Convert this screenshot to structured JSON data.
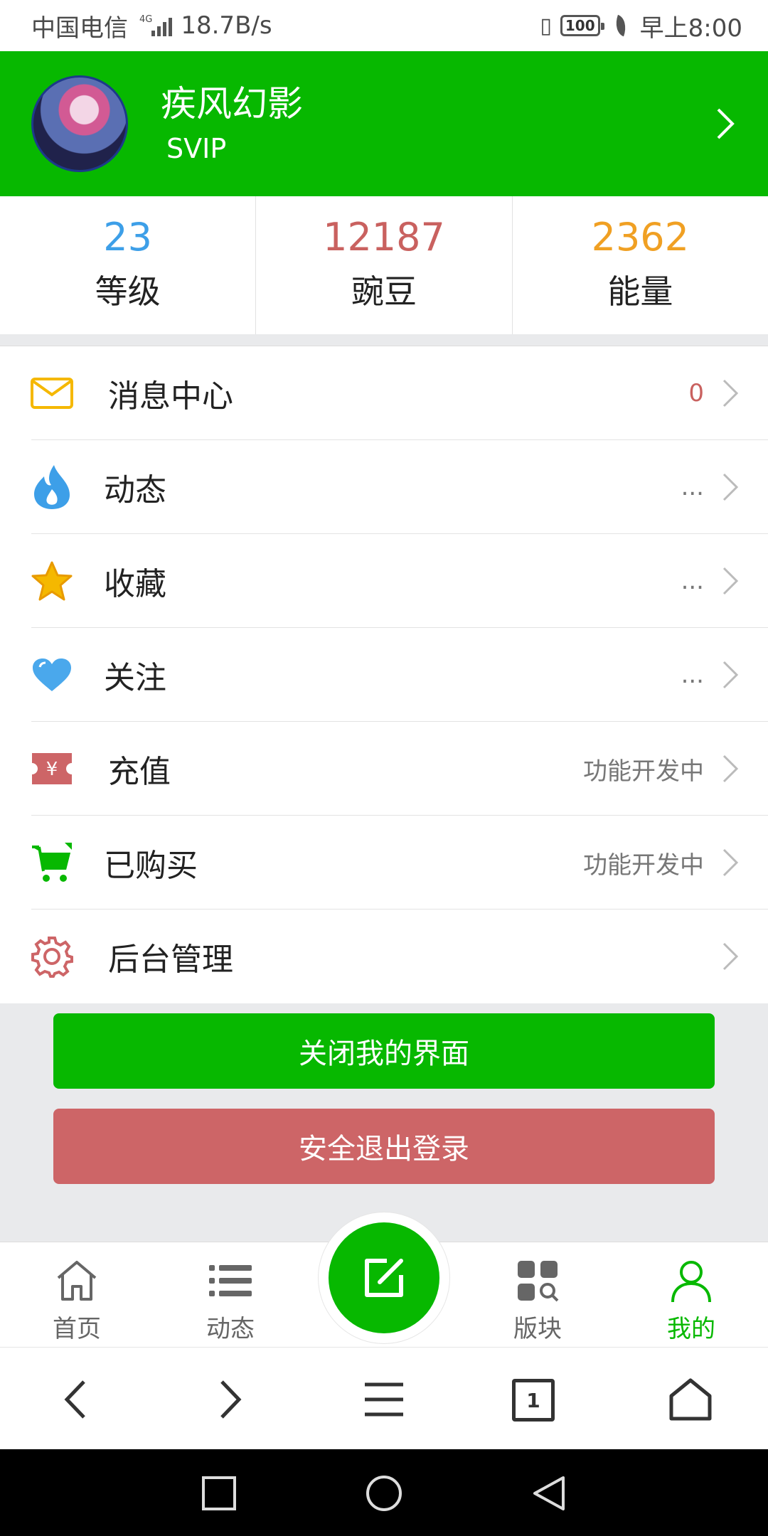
{
  "status_bar": {
    "carrier": "中国电信",
    "network_type": "4G",
    "speed": "18.7B/s",
    "battery": "100",
    "time": "早上8:00"
  },
  "profile": {
    "name": "疾风幻影",
    "level_badge": "SVIP"
  },
  "stats": [
    {
      "value": "23",
      "label": "等级",
      "color": "#3d9fe8"
    },
    {
      "value": "12187",
      "label": "豌豆",
      "color": "#c9615f"
    },
    {
      "value": "2362",
      "label": "能量",
      "color": "#f0a023"
    }
  ],
  "menu": [
    {
      "label": "消息中心",
      "value": "0",
      "value_color": "#c9615f",
      "icon": "mail-icon"
    },
    {
      "label": "动态",
      "value": "...",
      "icon": "flame-icon"
    },
    {
      "label": "收藏",
      "value": "...",
      "icon": "star-icon"
    },
    {
      "label": "关注",
      "value": "...",
      "icon": "heart-icon"
    },
    {
      "label": "充值",
      "value": "功能开发中",
      "icon": "yen-ticket-icon"
    },
    {
      "label": "已购买",
      "value": "功能开发中",
      "icon": "cart-icon"
    },
    {
      "label": "后台管理",
      "value": "",
      "icon": "gear-icon"
    }
  ],
  "buttons": {
    "close_label": "关闭我的界面",
    "logout_label": "安全退出登录"
  },
  "tabs": [
    {
      "label": "首页",
      "icon": "home-icon"
    },
    {
      "label": "动态",
      "icon": "list-icon"
    },
    {
      "label": "",
      "icon": "edit-icon"
    },
    {
      "label": "版块",
      "icon": "grid-search-icon"
    },
    {
      "label": "我的",
      "icon": "user-icon",
      "active": true
    }
  ],
  "browser_nav": {
    "tab_count": "1"
  },
  "colors": {
    "primary_green": "#07b800",
    "logout_red": "#cd6567"
  }
}
